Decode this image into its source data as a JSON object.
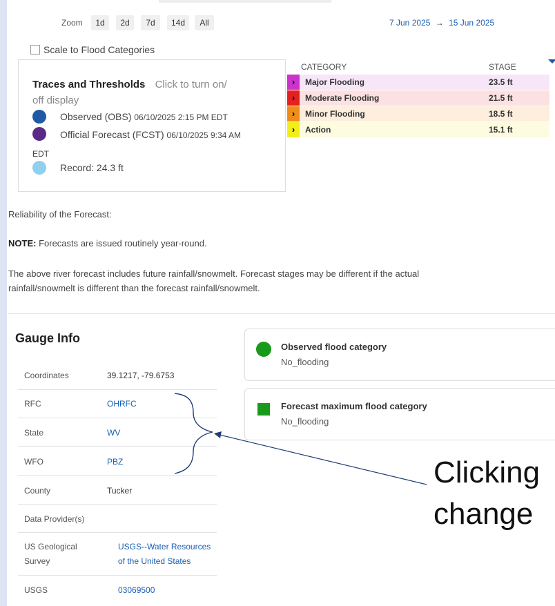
{
  "zoom": {
    "label": "Zoom",
    "buttons": [
      "1d",
      "2d",
      "7d",
      "14d",
      "All"
    ],
    "date_start": "7 Jun 2025",
    "arrow": "→",
    "date_end": "15 Jun 2025"
  },
  "scale_checkbox": {
    "label": "Scale to Flood Categories",
    "checked": false
  },
  "traces": {
    "title": "Traces and Thresholds",
    "hint_part1": "Click to turn on/",
    "hint_part2": "off display",
    "items": [
      {
        "label": "Observed (OBS)",
        "stamp": "06/10/2025 2:15 PM EDT",
        "color": "#1f5aa6"
      },
      {
        "label": "Official Forecast (FCST)",
        "stamp": "06/10/2025 9:34 AM",
        "stamp2": "EDT",
        "color": "#5b2a86"
      },
      {
        "label": "Record: 24.3 ft",
        "color": "#8fd0f0"
      }
    ]
  },
  "categories": {
    "header_category": "CATEGORY",
    "header_stage": "STAGE",
    "rows": [
      {
        "name": "Major Flooding",
        "stage": "23.5 ft",
        "marker": "#cc33cc",
        "bg": "#f6e6f7"
      },
      {
        "name": "Moderate Flooding",
        "stage": "21.5 ft",
        "marker": "#e62020",
        "bg": "#fbe1e1"
      },
      {
        "name": "Minor Flooding",
        "stage": "18.5 ft",
        "marker": "#f08c1a",
        "bg": "#fdeedd"
      },
      {
        "name": "Action",
        "stage": "15.1 ft",
        "marker": "#f2ee1a",
        "bg": "#fdfbe0"
      }
    ]
  },
  "reliability": "Reliability of the Forecast:",
  "note_label": "NOTE:",
  "note_text": "Forecasts are issued routinely year-round.",
  "forecast_text_line1": "The above river forecast includes future rainfall/snowmelt. Forecast stages may be different if the actual",
  "forecast_text_line2": "rainfall/snowmelt is different than the forecast rainfall/snowmelt.",
  "gauge_info": {
    "title": "Gauge Info",
    "rows": [
      {
        "key": "Coordinates",
        "value": "39.1217, -79.6753"
      },
      {
        "key": "RFC",
        "value": "OHRFC"
      },
      {
        "key": "State",
        "value": "WV"
      },
      {
        "key": "WFO",
        "value": "PBZ"
      },
      {
        "key": "County",
        "value": "Tucker"
      },
      {
        "key": "Data Provider(s)",
        "value": ""
      },
      {
        "key": "US Geological",
        "key2": "Survey",
        "value": "USGS--Water Resources",
        "value2": "of the United States"
      },
      {
        "key": "USGS",
        "value": "03069500"
      }
    ]
  },
  "observed_card": {
    "title": "Observed flood category",
    "value": "No_flooding",
    "color": "#1a9a1a"
  },
  "forecast_card": {
    "title": "Forecast maximum flood category",
    "value": "No_flooding",
    "color": "#1a9a1a"
  },
  "annotation": {
    "line1": "Clicking",
    "line2": "change",
    "color": "#1f3f7a"
  }
}
